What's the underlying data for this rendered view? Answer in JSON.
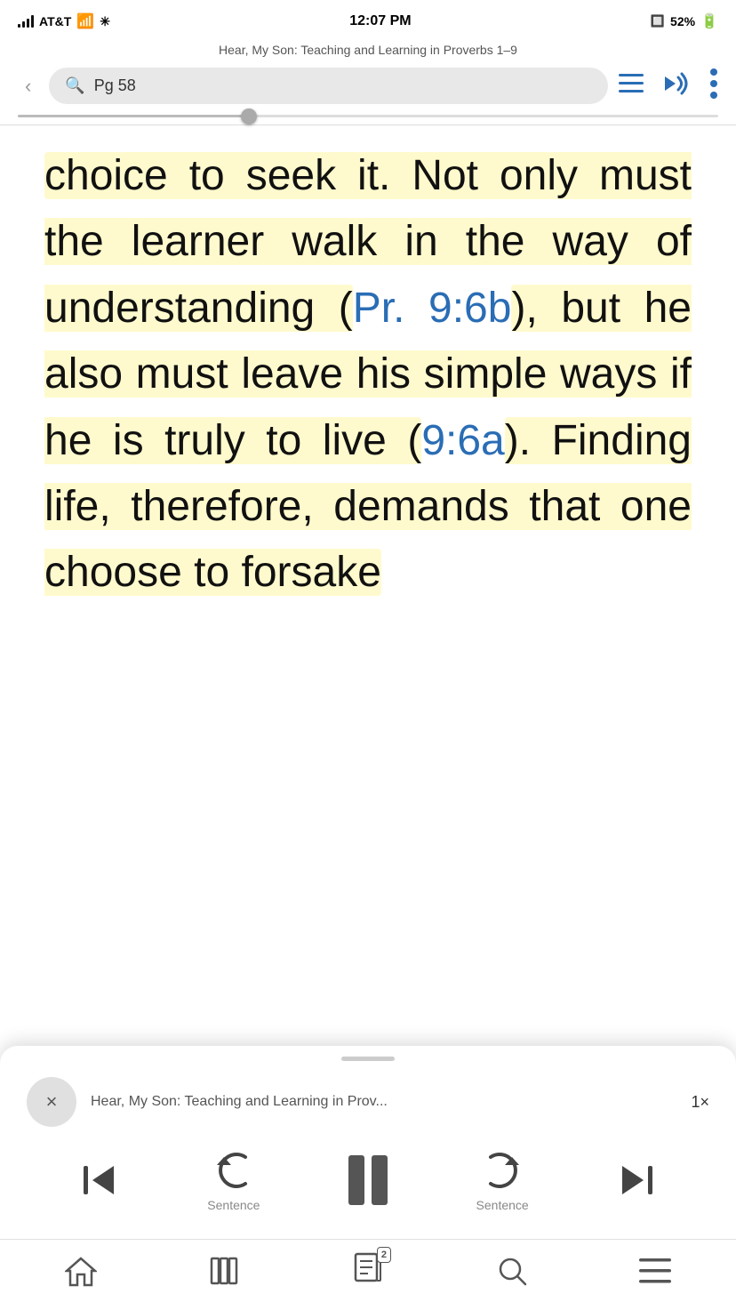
{
  "statusBar": {
    "carrier": "AT&T",
    "time": "12:07 PM",
    "battery": "52%",
    "batteryIcon": "🔋"
  },
  "bookTitle": "Hear, My Son: Teaching and Learning in Proverbs 1–9",
  "toolbar": {
    "backLabel": "‹",
    "searchPlaceholder": "Pg 58",
    "searchIconLabel": "🔍",
    "menuIconLabel": "≡",
    "audioIconLabel": "🔊",
    "moreIconLabel": "⋮"
  },
  "reading": {
    "text_part1": "choice to seek it. ",
    "highlight1": "Not only must the learner walk in the way of understanding (",
    "link1": "Pr. 9:6b",
    "highlight2": "), but he also must leave his simple ways if he is truly to live (",
    "link2": "9:6a",
    "highlight3": "). Finding life, therefore, demands that one choose to forsake"
  },
  "audioPlayer": {
    "closeLabel": "×",
    "title": "Hear, My Son: Teaching and Learning in Prov...",
    "speed": "1×",
    "controls": {
      "skipBack": "|◀",
      "rewindLabel": "Sentence",
      "forwardLabel": "Sentence",
      "skipForward": "▶|"
    }
  },
  "bottomNav": {
    "home": "⌂",
    "library": "📚",
    "notebook": "📋",
    "notebookBadge": "2",
    "search": "🔍",
    "menu": "≡"
  }
}
